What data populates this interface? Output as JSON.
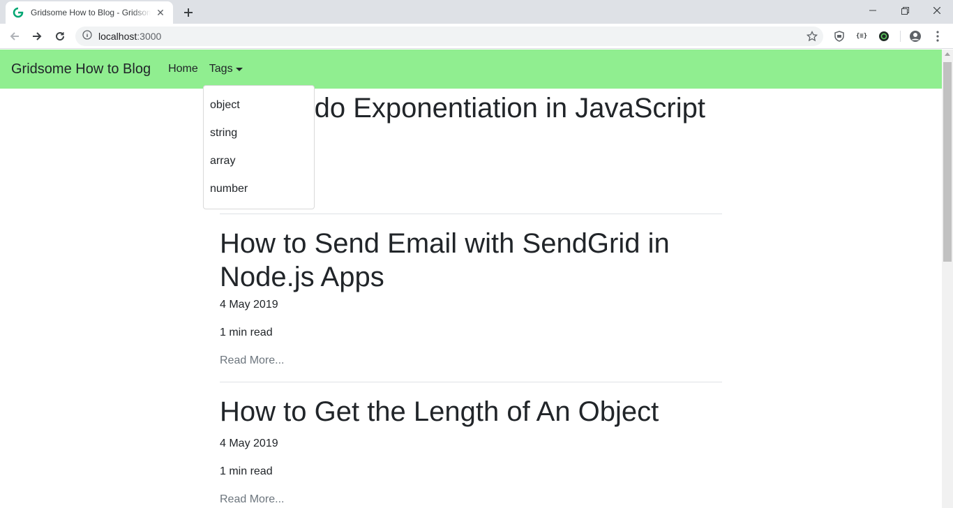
{
  "browser": {
    "tab_title": "Gridsome How to Blog - Gridsome",
    "url_host": "localhost",
    "url_port": ":3000"
  },
  "navbar": {
    "brand": "Gridsome How to Blog",
    "home": "Home",
    "tags": "Tags",
    "color": "#90ee90"
  },
  "dropdown": {
    "items": [
      "object",
      "string",
      "array",
      "number"
    ]
  },
  "posts": [
    {
      "title": "How to do Exponentiation in JavaScript",
      "visible_title": "do Exponentiation in JavaScript"
    },
    {
      "title": "How to Send Email with SendGrid in Node.js Apps",
      "date": "4 May 2019",
      "read_time": "1 min read",
      "read_more": "Read More..."
    },
    {
      "title": "How to Get the Length of An Object",
      "date": "4 May 2019",
      "read_time": "1 min read",
      "read_more": "Read More..."
    }
  ],
  "icons": {
    "favicon": "gridsome-logo-icon",
    "back": "arrow-left-icon",
    "forward": "arrow-right-icon",
    "reload": "reload-icon",
    "info": "info-icon",
    "bookmark": "star-icon",
    "account": "account-icon",
    "menu": "kebab-menu-icon"
  }
}
